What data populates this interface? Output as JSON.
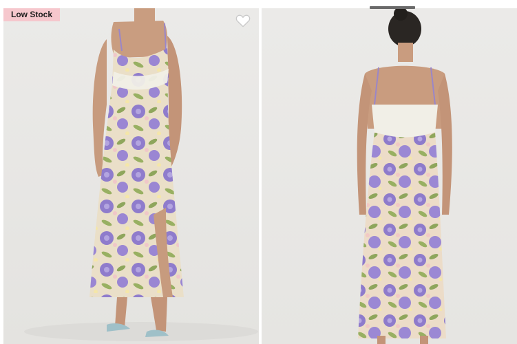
{
  "product": {
    "badge_text": "Low Stock"
  },
  "gallery": {
    "images": [
      {
        "view": "front"
      },
      {
        "view": "back"
      }
    ]
  },
  "icons": {
    "wishlist": "heart-outline-icon"
  },
  "colors": {
    "badge_bg": "#f6c7cd",
    "photo_bg": "#e9e8e6",
    "floral_purple": "#8d78c9",
    "floral_green": "#8ea65c",
    "floral_cream": "#efe3c6",
    "lace": "#f1efe7"
  }
}
